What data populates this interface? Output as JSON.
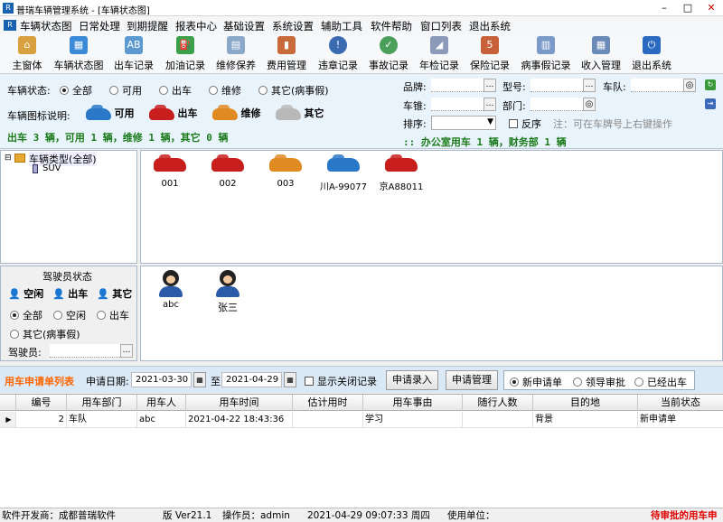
{
  "window": {
    "title": "普瑞车辆管理系统 - [车辆状态图]"
  },
  "menu": [
    "车辆状态图",
    "日常处理",
    "到期提醒",
    "报表中心",
    "基础设置",
    "系统设置",
    "辅助工具",
    "软件帮助",
    "窗口列表",
    "退出系统"
  ],
  "toolbar": [
    "主窗体",
    "车辆状态图",
    "出车记录",
    "加油记录",
    "维修保养",
    "费用管理",
    "违章记录",
    "事故记录",
    "年检记录",
    "保险记录",
    "病事假记录",
    "收入管理",
    "退出系统"
  ],
  "filter": {
    "status_label": "车辆状态:",
    "status_options": [
      "全部",
      "可用",
      "出车",
      "维修",
      "其它(病事假)"
    ],
    "legend_label": "车辆图标说明:",
    "legend": [
      "可用",
      "出车",
      "维修",
      "其它"
    ],
    "summary": "出车 3 辆，可用 1 辆，维修 1 辆，其它 0 辆",
    "brand_label": "品牌:",
    "model_label": "型号:",
    "team_label": "车队:",
    "color_label": "车锥:",
    "dept_label": "部门:",
    "sort_label": "排序:",
    "reverse_label": "反序",
    "note": "注：可在车牌号上右键操作",
    "dept_summary": "办公室用车 1 辆，财务部 1 辆",
    "dept_summary_prefix": "::"
  },
  "tree": {
    "root": "车辆类型(全部)",
    "child": "SUV"
  },
  "cars": [
    {
      "name": "001",
      "color": "#c81e1e"
    },
    {
      "name": "002",
      "color": "#c81e1e"
    },
    {
      "name": "003",
      "color": "#e08a22"
    },
    {
      "name": "川A-99077",
      "color": "#2a78c8"
    },
    {
      "name": "京A88011",
      "color": "#c81e1e"
    }
  ],
  "driver_status": {
    "title": "驾驶员状态",
    "legend": [
      "空闲",
      "出车",
      "其它"
    ],
    "options": [
      "全部",
      "空闲",
      "出车",
      "其它(病事假)"
    ],
    "driver_label": "驾驶员:"
  },
  "drivers": [
    "abc",
    "张三"
  ],
  "request": {
    "title": "用车申请单列表",
    "date_label": "申请日期:",
    "date_from": "2021-03-30",
    "to_label": "至",
    "date_to": "2021-04-29",
    "show_closed": "显示关闭记录",
    "btn_enter": "申请录入",
    "btn_manage": "申请管理",
    "options": [
      "新申请单",
      "领导审批",
      "已经出车"
    ]
  },
  "grid": {
    "columns": [
      "编号",
      "用车部门",
      "用车人",
      "用车时间",
      "估计用时",
      "用车事由",
      "随行人数",
      "目的地",
      "当前状态"
    ],
    "rows": [
      [
        "2",
        "车队",
        "abc",
        "2021-04-22 18:43:36",
        "",
        "学习",
        "",
        "背景",
        "新申请单"
      ]
    ]
  },
  "status": {
    "dev": "软件开发商：成都普瑞软件",
    "version": "版 Ver21.1",
    "operator": "操作员：admin",
    "datetime": "2021-04-29 09:07:33 周四",
    "unit": "使用单位：",
    "alert": "待审批的用车申"
  },
  "colors": {
    "accent": "#ff6600",
    "summary_green": "#1a7a1a",
    "alert_red": "#e00000"
  }
}
